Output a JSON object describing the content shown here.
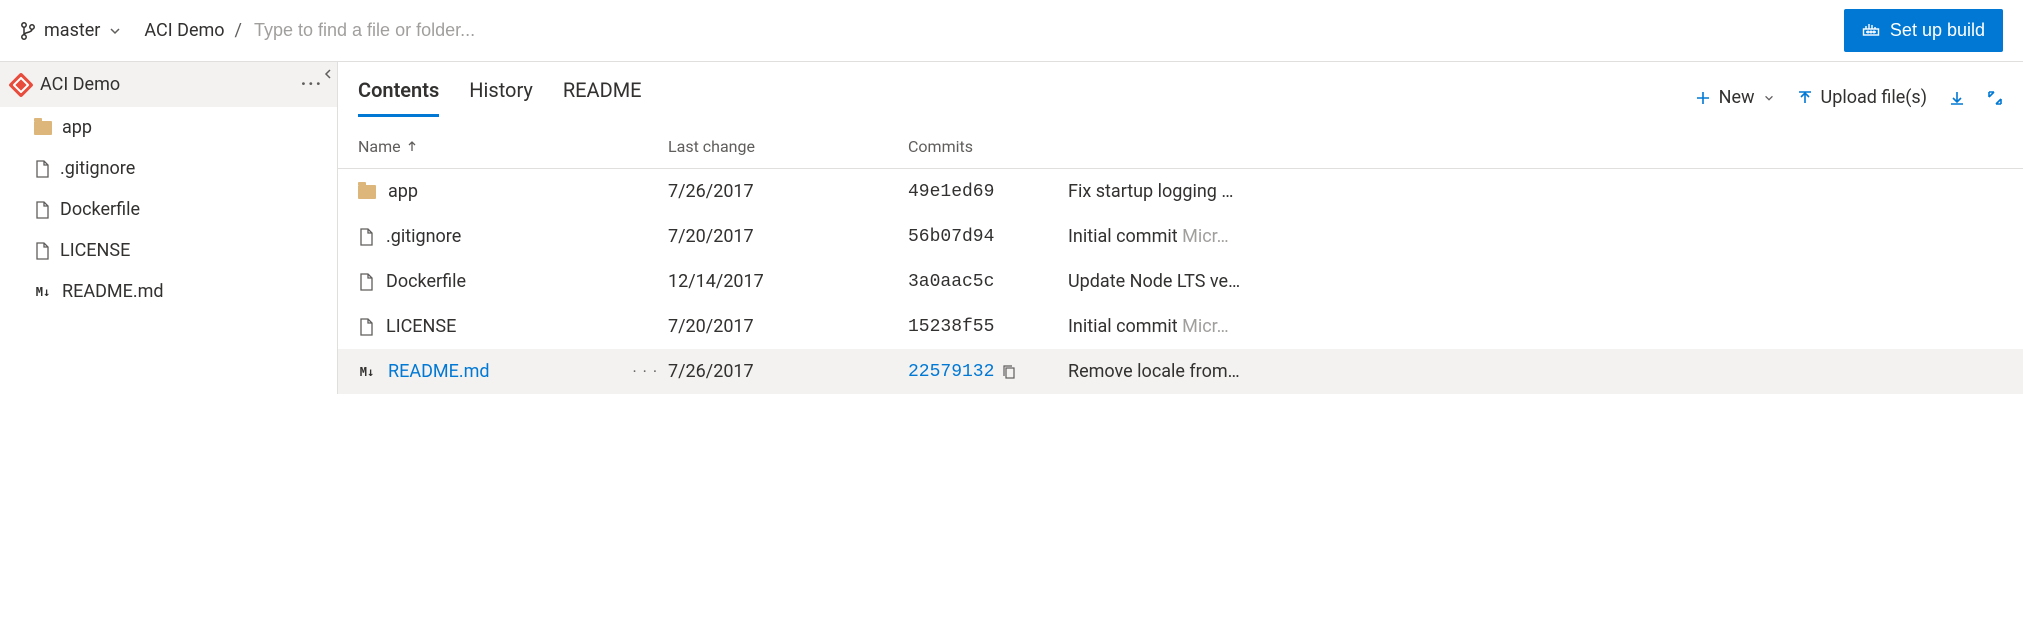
{
  "topbar": {
    "branch": "master",
    "repo": "ACI Demo",
    "search_placeholder": "Type to find a file or folder...",
    "setup_build": "Set up build"
  },
  "sidebar": {
    "root": "ACI Demo",
    "items": [
      {
        "type": "folder",
        "name": "app"
      },
      {
        "type": "file",
        "name": ".gitignore"
      },
      {
        "type": "file",
        "name": "Dockerfile"
      },
      {
        "type": "file",
        "name": "LICENSE"
      },
      {
        "type": "md",
        "name": "README.md"
      }
    ]
  },
  "tabs": {
    "contents": "Contents",
    "history": "History",
    "readme": "README"
  },
  "actions": {
    "new": "New",
    "upload": "Upload file(s)"
  },
  "columns": {
    "name": "Name",
    "last_change": "Last change",
    "commits": "Commits"
  },
  "rows": [
    {
      "type": "folder",
      "name": "app",
      "date": "7/26/2017",
      "commit": "49e1ed69",
      "msg": "Fix startup logging …",
      "author": "",
      "selected": false,
      "link": false
    },
    {
      "type": "file",
      "name": ".gitignore",
      "date": "7/20/2017",
      "commit": "56b07d94",
      "msg": "Initial commit",
      "author": "Micr…",
      "selected": false,
      "link": false
    },
    {
      "type": "file",
      "name": "Dockerfile",
      "date": "12/14/2017",
      "commit": "3a0aac5c",
      "msg": "Update Node LTS ve…",
      "author": "",
      "selected": false,
      "link": false
    },
    {
      "type": "file",
      "name": "LICENSE",
      "date": "7/20/2017",
      "commit": "15238f55",
      "msg": "Initial commit",
      "author": "Micr…",
      "selected": false,
      "link": false
    },
    {
      "type": "md",
      "name": "README.md",
      "date": "7/26/2017",
      "commit": "22579132",
      "msg": "Remove locale from…",
      "author": "",
      "selected": true,
      "link": true
    }
  ]
}
